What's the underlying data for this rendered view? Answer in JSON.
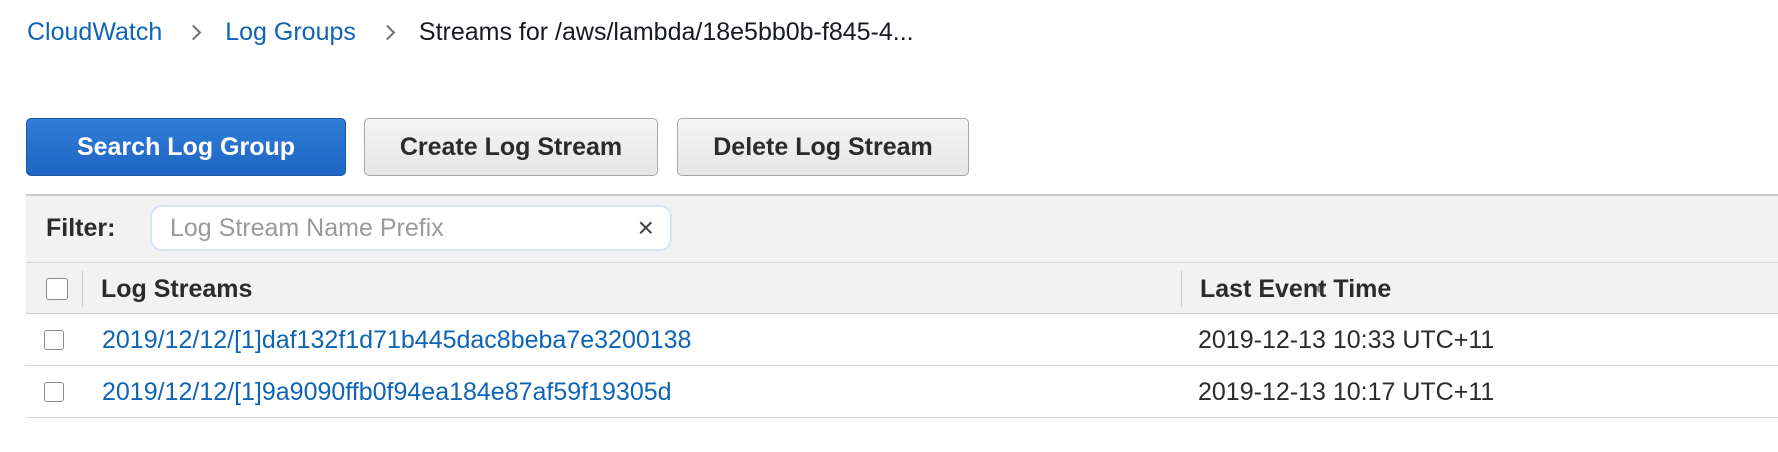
{
  "breadcrumb": {
    "items": [
      {
        "label": "CloudWatch"
      },
      {
        "label": "Log Groups"
      }
    ],
    "current": "Streams for /aws/lambda/18e5bb0b-f845-4..."
  },
  "toolbar": {
    "search_label": "Search Log Group",
    "create_label": "Create Log Stream",
    "delete_label": "Delete Log Stream"
  },
  "filter": {
    "label": "Filter:",
    "placeholder": "Log Stream Name Prefix",
    "value": "",
    "clear_icon": "×"
  },
  "table": {
    "columns": [
      "Log Streams",
      "Last Event Time"
    ],
    "rows": [
      {
        "name": "2019/12/12/[1]daf132f1d71b445dac8beba7e3200138",
        "last_event": "2019-12-13 10:33 UTC+11"
      },
      {
        "name": "2019/12/12/[1]9a9090ffb0f94ea184e87af59f19305d",
        "last_event": "2019-12-13 10:17 UTC+11"
      }
    ]
  },
  "colors": {
    "link": "#0e64b5",
    "primary_button": "#1f64c2",
    "header_bg": "#f2f2f2"
  }
}
